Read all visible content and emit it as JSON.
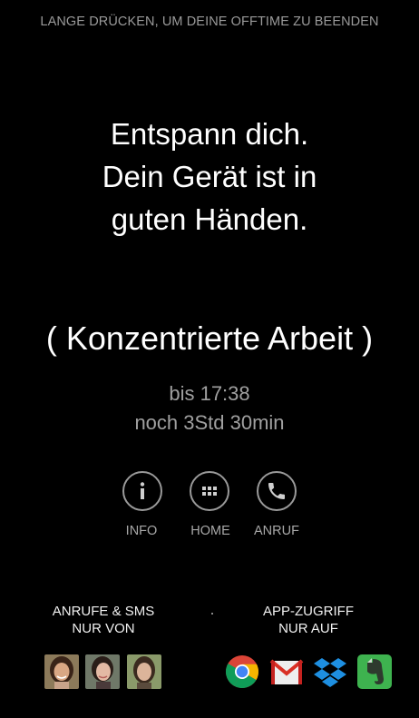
{
  "hint": "LANGE DRÜCKEN, UM DEINE OFFTIME ZU BEENDEN",
  "message": {
    "line1": "Entspann dich.",
    "line2": "Dein Gerät ist in",
    "line3": "guten Händen."
  },
  "mode_label": "( Konzentrierte Arbeit )",
  "until": "bis 17:38",
  "remaining": "noch 3Std 30min",
  "actions": {
    "info": "INFO",
    "home": "HOME",
    "call": "ANRUF"
  },
  "calls_section": {
    "line1": "ANRUFE & SMS",
    "line2": "NUR VON"
  },
  "apps_section": {
    "line1": "APP-ZUGRIFF",
    "line2": "NUR AUF"
  },
  "contacts": [
    "contact-1",
    "contact-2",
    "contact-3"
  ],
  "apps": [
    "chrome-icon",
    "gmail-icon",
    "dropbox-icon",
    "evernote-icon"
  ],
  "colors": {
    "background": "#000000",
    "text": "#ffffff",
    "muted": "#a0a0a0"
  }
}
